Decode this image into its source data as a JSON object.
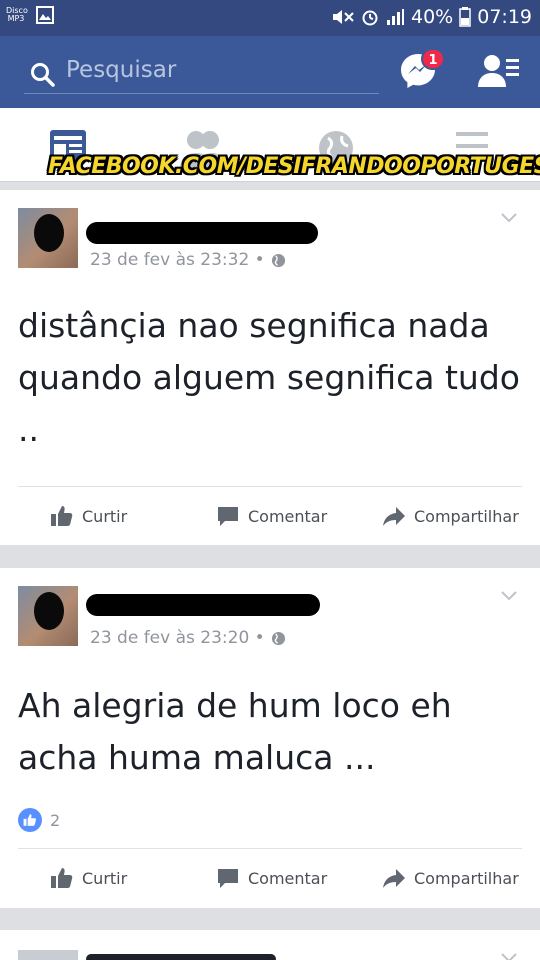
{
  "status_bar": {
    "left_label": "Disco MP3",
    "battery": "40%",
    "time": "07:19"
  },
  "header": {
    "search_placeholder": "Pesquisar",
    "messenger_badge": "1"
  },
  "tabs": [
    {
      "name": "feed",
      "icon": "newsfeed-icon"
    },
    {
      "name": "friends",
      "icon": "friends-icon"
    },
    {
      "name": "notifications",
      "icon": "globe-icon"
    },
    {
      "name": "menu",
      "icon": "menu-icon"
    }
  ],
  "watermark": "FACEBOOK.COM/DESIFRANDOOPORTUGES",
  "posts": [
    {
      "timestamp": "23 de fev às 23:32 •",
      "text": "distânçia nao segnifica nada quando alguem segnifica tudo ..",
      "reactions": ""
    },
    {
      "timestamp": "23 de fev às 23:20 •",
      "text": "Ah alegria de hum loco eh acha huma maluca ...",
      "reactions": "2"
    }
  ],
  "actions": {
    "like": "Curtir",
    "comment": "Comentar",
    "share": "Compartilhar"
  },
  "colors": {
    "brand": "#3b5998",
    "status_bar": "#34497f",
    "badge": "#f02849",
    "like_blue": "#5890ff"
  }
}
